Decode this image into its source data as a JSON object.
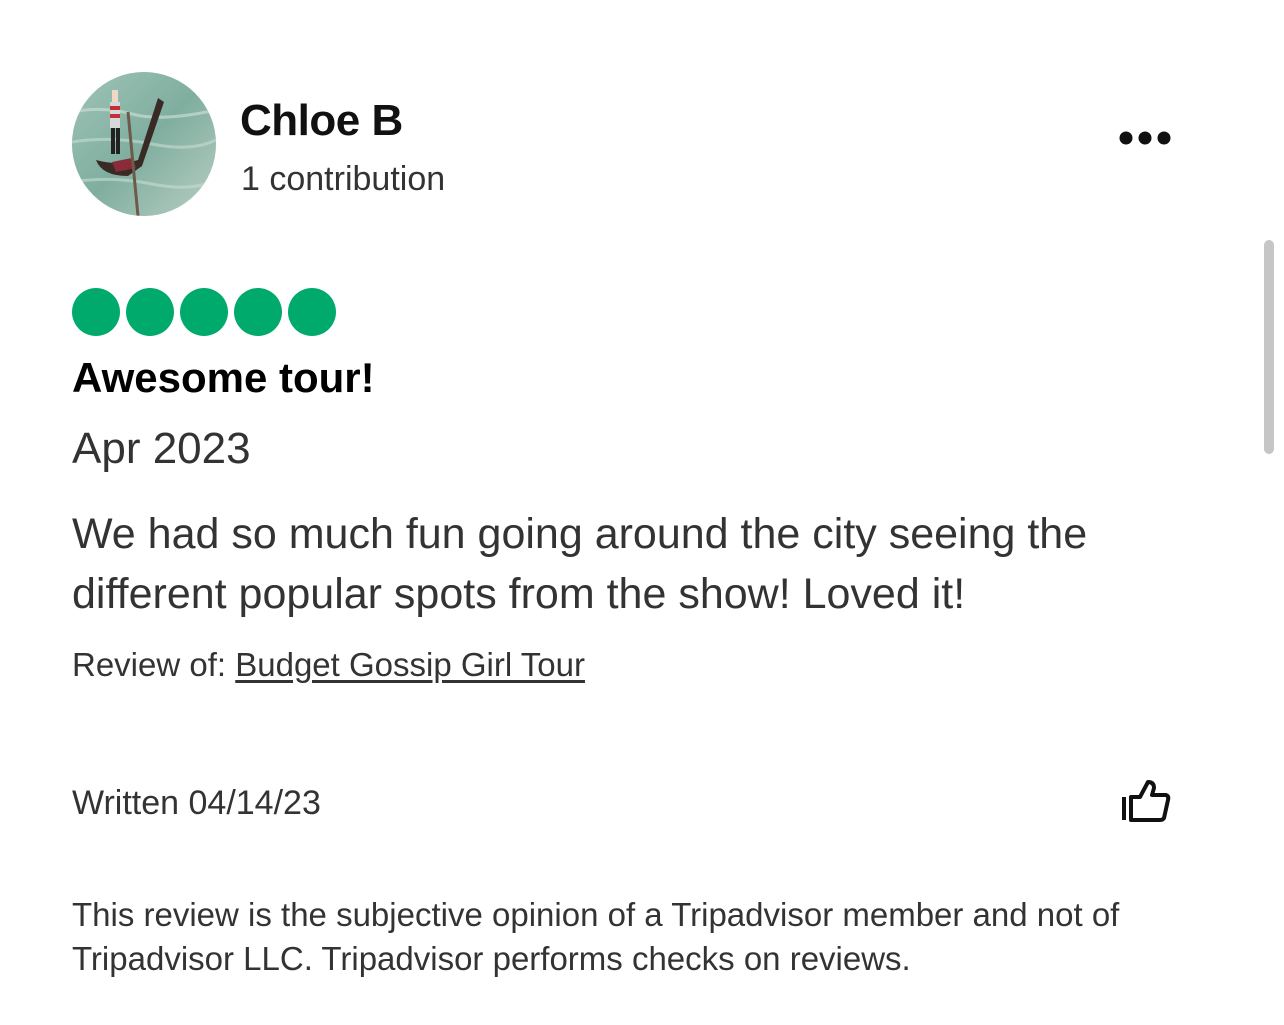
{
  "user": {
    "name": "Chloe B",
    "contributions": "1 contribution"
  },
  "rating": {
    "value": 5,
    "max": 5,
    "color": "#00aa6c"
  },
  "review": {
    "title": "Awesome tour!",
    "date": "Apr 2023",
    "body": "We had so much fun going around the city seeing the different popular spots from the show! Loved it!",
    "review_of_label": "Review of:",
    "review_of_link": "Budget Gossip Girl Tour",
    "written": "Written 04/14/23"
  },
  "icons": {
    "more": "more-horizontal-icon",
    "helpful": "thumbs-up-icon"
  },
  "disclaimer": "This review is the subjective opinion of a Tripadvisor member and not of Tripadvisor LLC. Tripadvisor performs checks on reviews."
}
